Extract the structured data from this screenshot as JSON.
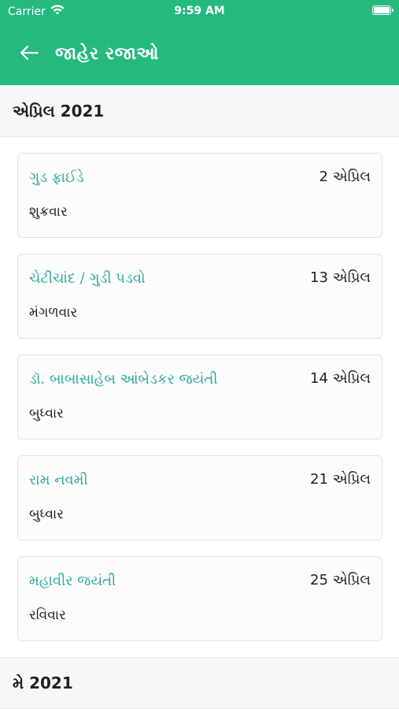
{
  "status": {
    "carrier": "Carrier",
    "time": "9:59 AM"
  },
  "nav": {
    "title": "જાહેર રજાઓ"
  },
  "sections": [
    {
      "title": "એપ્રિલ 2021"
    },
    {
      "title": "મે 2021"
    }
  ],
  "holidays": [
    {
      "name": "ગુડ ફ્રાઈડે",
      "date": "2 એપ્રિલ",
      "day": "શુક્રવાર"
    },
    {
      "name": "ચેટીચાંદ / ગુડી પડવો",
      "date": "13 એપ્રિલ",
      "day": "મંગળવાર"
    },
    {
      "name": "ડૉ. બાબાસાહેબ આંબેડકર જયંતી",
      "date": "14 એપ્રિલ",
      "day": "બુધ્વાર"
    },
    {
      "name": "રામ નવમી",
      "date": "21 એપ્રિલ",
      "day": "બુધ્વાર"
    },
    {
      "name": "મહાવીર જયંતી",
      "date": "25 એપ્રિલ",
      "day": "રવિવાર"
    }
  ],
  "colors": {
    "header": "#25b97e",
    "holiday_name": "#2eaaa0"
  },
  "icons": {
    "wifi": "wifi-icon",
    "battery": "battery-icon",
    "back": "back-arrow-icon"
  }
}
